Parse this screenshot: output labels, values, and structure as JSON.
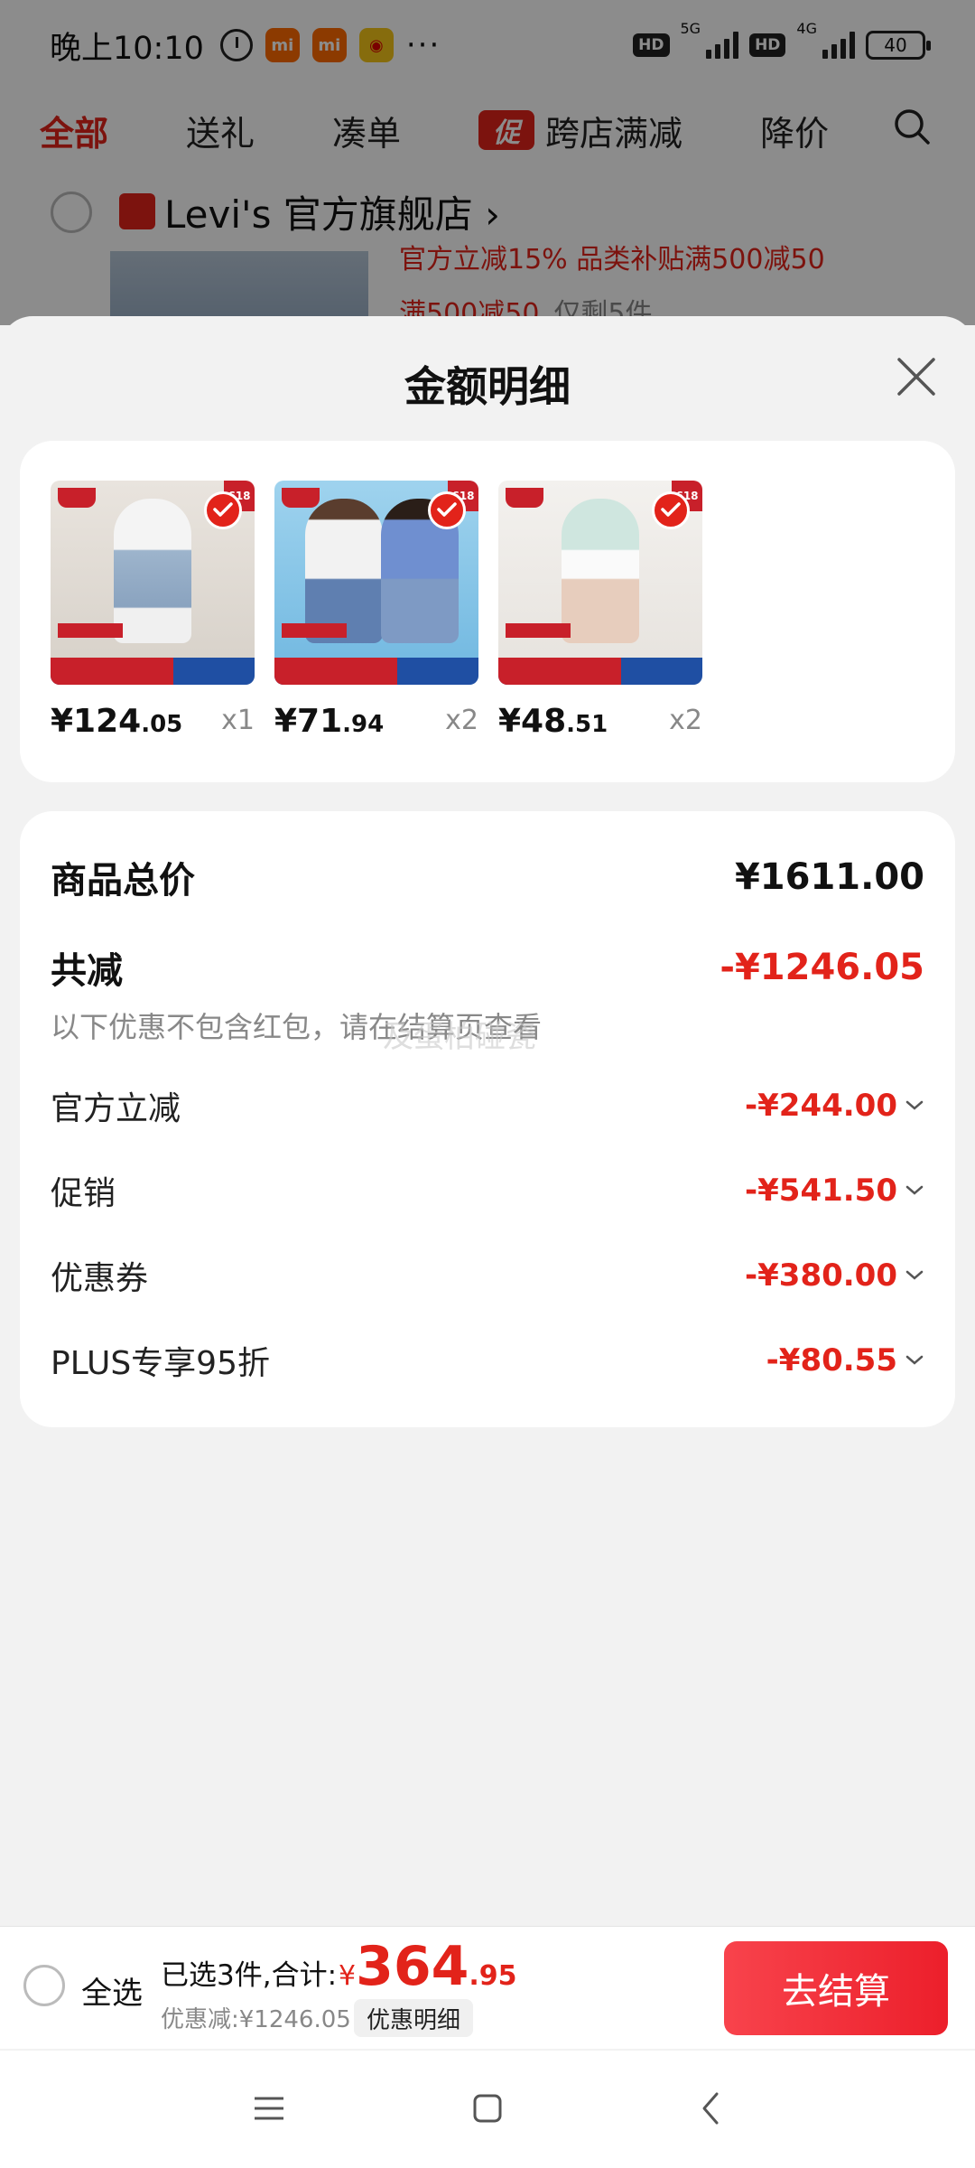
{
  "status_bar": {
    "time": "晚上10:10",
    "app_badges": [
      "mi",
      "mi",
      "weibo"
    ],
    "more": "···",
    "hd": "HD",
    "net_5g": "5G",
    "net_4g": "4G",
    "battery": "40"
  },
  "tabs": [
    {
      "label": "全部",
      "active": true
    },
    {
      "label": "送礼"
    },
    {
      "label": "凑单"
    },
    {
      "label": "跨店满减",
      "badge": "促"
    },
    {
      "label": "降价"
    }
  ],
  "store": {
    "name": "Levi's 官方旗舰店 ›",
    "promo_line1": "官方立减15% 品类补贴满500减50",
    "promo_line2": "满500减50",
    "promo_line2_stock": "仅剩5件"
  },
  "sheet": {
    "title": "金额明细",
    "items": [
      {
        "price_int": "¥124",
        "price_dec": ".05",
        "qty": "x1",
        "badge": "618"
      },
      {
        "price_int": "¥71",
        "price_dec": ".94",
        "qty": "x2",
        "badge": "618"
      },
      {
        "price_int": "¥48",
        "price_dec": ".51",
        "qty": "x2",
        "badge": "618"
      }
    ],
    "total_label": "商品总价",
    "total_value": "¥1611.00",
    "discount_label": "共减",
    "discount_value": "-¥1246.05",
    "note": "以下优惠不包含红包，请在结算页查看",
    "watermark": "及蛋柏碰瓷",
    "breakdown": [
      {
        "label": "官方立减",
        "value": "-¥244.00"
      },
      {
        "label": "促销",
        "value": "-¥541.50"
      },
      {
        "label": "优惠券",
        "value": "-¥380.00"
      },
      {
        "label": "PLUS专享95折",
        "value": "-¥80.55"
      }
    ]
  },
  "bottom_bar": {
    "select_all": "全选",
    "summary_prefix": "已选3件,合计:",
    "currency": "¥",
    "total_int": "364",
    "total_dec": ".95",
    "saved": "优惠减:¥1246.05",
    "detail_button": "优惠明细",
    "checkout_button": "去结算"
  },
  "colors": {
    "accent": "#e2231a",
    "checkout_start": "#f8434c",
    "checkout_end": "#ec1f2b"
  }
}
